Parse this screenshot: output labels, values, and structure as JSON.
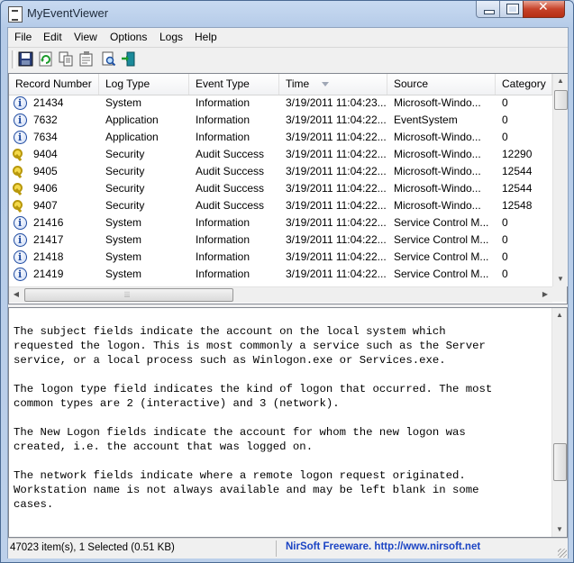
{
  "window": {
    "title": "MyEventViewer"
  },
  "menu": [
    "File",
    "Edit",
    "View",
    "Options",
    "Logs",
    "Help"
  ],
  "toolbar": {
    "icons": [
      "save-icon",
      "refresh-icon",
      "copy-icon",
      "properties-icon",
      "find-icon",
      "exit-icon"
    ]
  },
  "columns": [
    "Record Number",
    "Log Type",
    "Event Type",
    "Time",
    "Source",
    "Category"
  ],
  "rows": [
    {
      "icon": "info",
      "record": "21434",
      "log": "System",
      "event": "Information",
      "time": "3/19/2011 11:04:23...",
      "source": "Microsoft-Windo...",
      "category": "0"
    },
    {
      "icon": "info",
      "record": "7632",
      "log": "Application",
      "event": "Information",
      "time": "3/19/2011 11:04:22...",
      "source": "EventSystem",
      "category": "0"
    },
    {
      "icon": "info",
      "record": "7634",
      "log": "Application",
      "event": "Information",
      "time": "3/19/2011 11:04:22...",
      "source": "Microsoft-Windo...",
      "category": "0"
    },
    {
      "icon": "key",
      "record": "9404",
      "log": "Security",
      "event": "Audit Success",
      "time": "3/19/2011 11:04:22...",
      "source": "Microsoft-Windo...",
      "category": "12290"
    },
    {
      "icon": "key",
      "record": "9405",
      "log": "Security",
      "event": "Audit Success",
      "time": "3/19/2011 11:04:22...",
      "source": "Microsoft-Windo...",
      "category": "12544"
    },
    {
      "icon": "key",
      "record": "9406",
      "log": "Security",
      "event": "Audit Success",
      "time": "3/19/2011 11:04:22...",
      "source": "Microsoft-Windo...",
      "category": "12544"
    },
    {
      "icon": "key",
      "record": "9407",
      "log": "Security",
      "event": "Audit Success",
      "time": "3/19/2011 11:04:22...",
      "source": "Microsoft-Windo...",
      "category": "12548"
    },
    {
      "icon": "info",
      "record": "21416",
      "log": "System",
      "event": "Information",
      "time": "3/19/2011 11:04:22...",
      "source": "Service Control M...",
      "category": "0"
    },
    {
      "icon": "info",
      "record": "21417",
      "log": "System",
      "event": "Information",
      "time": "3/19/2011 11:04:22...",
      "source": "Service Control M...",
      "category": "0"
    },
    {
      "icon": "info",
      "record": "21418",
      "log": "System",
      "event": "Information",
      "time": "3/19/2011 11:04:22...",
      "source": "Service Control M...",
      "category": "0"
    },
    {
      "icon": "info",
      "record": "21419",
      "log": "System",
      "event": "Information",
      "time": "3/19/2011 11:04:22...",
      "source": "Service Control M...",
      "category": "0"
    }
  ],
  "detail": {
    "text": "The subject fields indicate the account on the local system which\nrequested the logon. This is most commonly a service such as the Server\nservice, or a local process such as Winlogon.exe or Services.exe.\n\nThe logon type field indicates the kind of logon that occurred. The most\ncommon types are 2 (interactive) and 3 (network).\n\nThe New Logon fields indicate the account for whom the new logon was\ncreated, i.e. the account that was logged on.\n\nThe network fields indicate where a remote logon request originated.\nWorkstation name is not always available and may be left blank in some\ncases."
  },
  "status": {
    "items": "47023 item(s), 1 Selected  (0.51 KB)",
    "link": "NirSoft Freeware.  http://www.nirsoft.net"
  },
  "colors": {
    "link": "#1b44c4",
    "close_button": "#c7432a"
  }
}
